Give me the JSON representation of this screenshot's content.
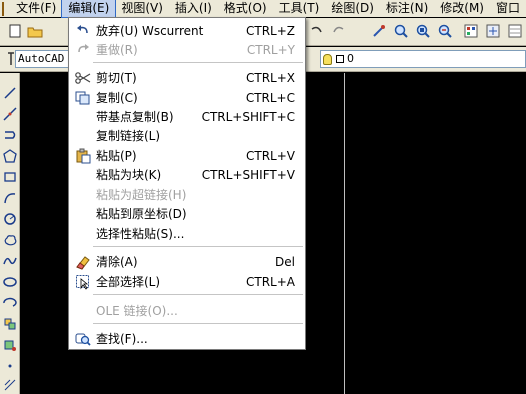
{
  "menubar": {
    "items": [
      {
        "label": "文件(F)"
      },
      {
        "label": "编辑(E)"
      },
      {
        "label": "视图(V)"
      },
      {
        "label": "插入(I)"
      },
      {
        "label": "格式(O)"
      },
      {
        "label": "工具(T)"
      },
      {
        "label": "绘图(D)"
      },
      {
        "label": "标注(N)"
      },
      {
        "label": "修改(M)"
      },
      {
        "label": "窗口"
      }
    ]
  },
  "toolbar": {
    "text_style_value": "AutoCAD 经",
    "layer_value": "0"
  },
  "edit_menu": {
    "items": [
      {
        "label": "放弃(U) Wscurrent",
        "shortcut": "CTRL+Z",
        "icon": "undo-icon"
      },
      {
        "label": "重做(R)",
        "shortcut": "CTRL+Y",
        "icon": "redo-icon"
      },
      {
        "label": "剪切(T)",
        "shortcut": "CTRL+X",
        "icon": "scissors-icon"
      },
      {
        "label": "复制(C)",
        "shortcut": "CTRL+C",
        "icon": "copy-icon"
      },
      {
        "label": "带基点复制(B)",
        "shortcut": "CTRL+SHIFT+C"
      },
      {
        "label": "复制链接(L)",
        "shortcut": ""
      },
      {
        "label": "粘贴(P)",
        "shortcut": "CTRL+V",
        "icon": "paste-icon"
      },
      {
        "label": "粘贴为块(K)",
        "shortcut": "CTRL+SHIFT+V"
      },
      {
        "label": "粘贴为超链接(H)",
        "shortcut": ""
      },
      {
        "label": "粘贴到原坐标(D)",
        "shortcut": ""
      },
      {
        "label": "选择性粘贴(S)...",
        "shortcut": ""
      },
      {
        "label": "清除(A)",
        "shortcut": "Del",
        "icon": "eraser-icon"
      },
      {
        "label": "全部选择(L)",
        "shortcut": "CTRL+A",
        "icon": "select-all-icon"
      },
      {
        "label": "OLE 链接(O)...",
        "shortcut": ""
      },
      {
        "label": "查找(F)...",
        "shortcut": "",
        "icon": "find-icon"
      }
    ]
  }
}
